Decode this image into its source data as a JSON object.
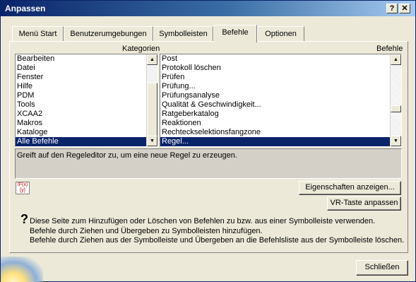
{
  "window": {
    "title": "Anpassen",
    "help_button": "?",
    "close_button": "✕"
  },
  "tabs": [
    {
      "label": "Menü Start"
    },
    {
      "label": "Benutzerumgebungen"
    },
    {
      "label": "Symbolleisten"
    },
    {
      "label": "Befehle"
    },
    {
      "label": "Optionen"
    }
  ],
  "active_tab": "Befehle",
  "categories": {
    "caption": "Kategorien",
    "items": [
      "Bearbeiten",
      "Datei",
      "Fenster",
      "Hilfe",
      "PDM",
      "Tools",
      "XCAA2",
      "Makros",
      "Kataloge",
      "Alle Befehle"
    ],
    "selected": "Alle Befehle"
  },
  "commands": {
    "caption": "Befehle",
    "items": [
      "Post",
      "Protokoll löschen",
      "Prüfen",
      "Prüfung...",
      "Prüfungsanalyse",
      "Qualität & Geschwindigkeit...",
      "Ratgeberkatalog",
      "Reaktionen",
      "Rechteckselektionsfangzone",
      "Regel..."
    ],
    "selected": "Regel..."
  },
  "description": "Greift auf den Regeleditor zu, um eine neue Regel zu erzeugen.",
  "command_icon": {
    "name": "rule-icon",
    "text": "IF(x)\n{y}"
  },
  "buttons": {
    "properties": "Eigenschaften anzeigen...",
    "vr_key": "VR-Taste anpassen",
    "close": "Schließen"
  },
  "help": {
    "icon": "?",
    "lines": [
      "Diese Seite zum Hinzufügen oder Löschen von Befehlen zu bzw. aus einer Symbolleiste verwenden.",
      "Befehle durch Ziehen und Übergeben zu Symbolleisten hinzufügen.",
      "Befehle durch Ziehen aus der Symbolleiste und Übergeben an die Befehlsliste aus der Symbolleiste löschen."
    ]
  }
}
